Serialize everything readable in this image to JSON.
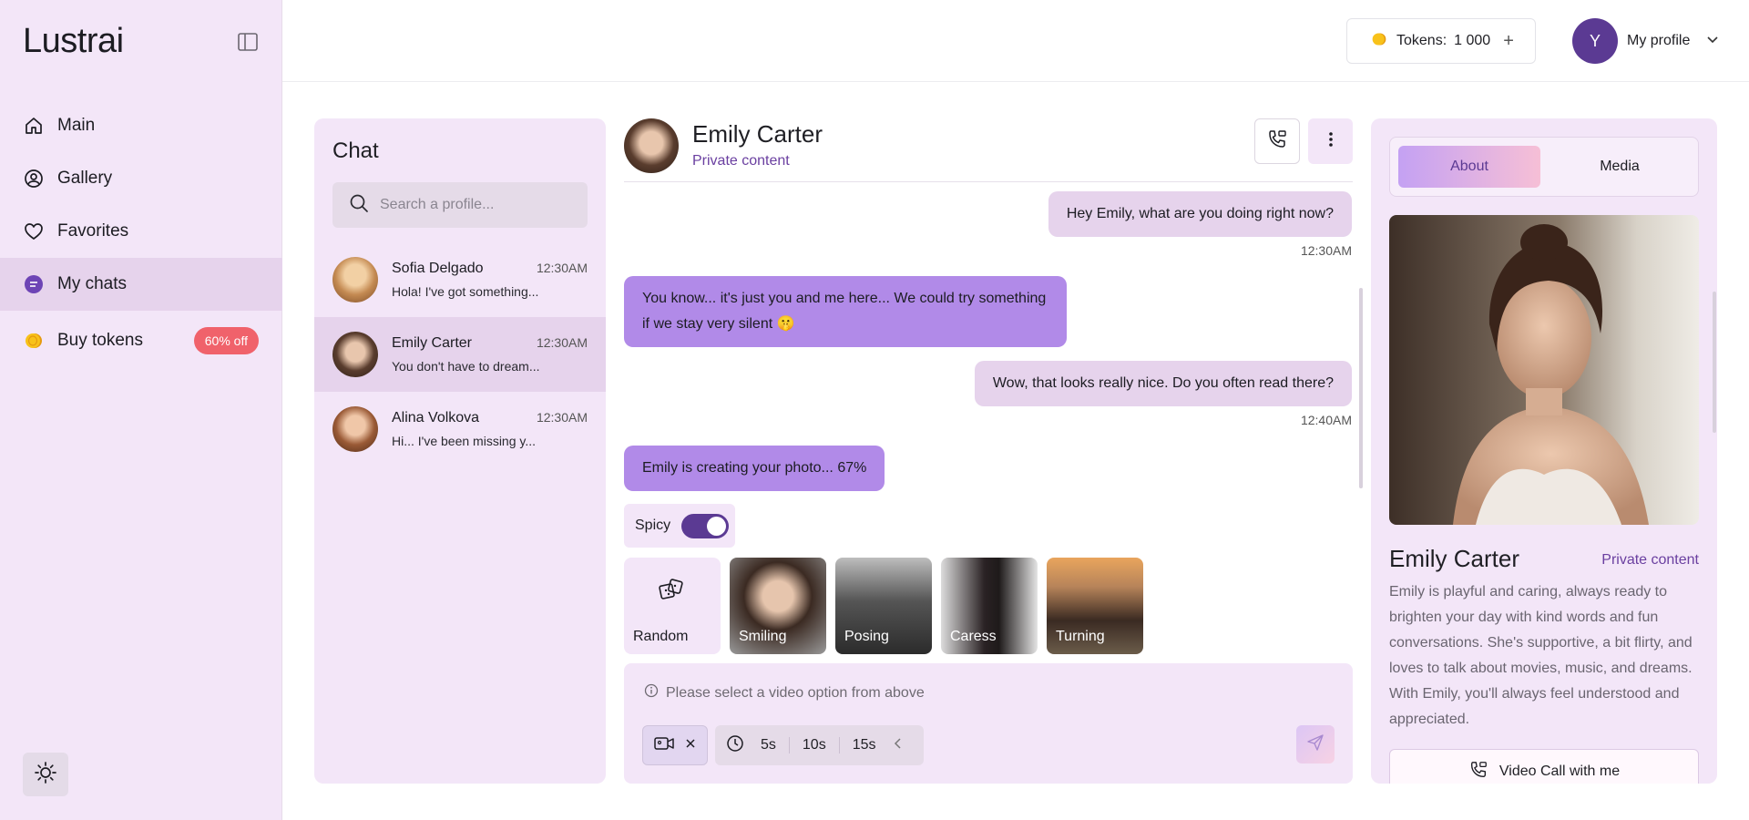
{
  "brand": "Lustrai",
  "nav": [
    {
      "label": "Main",
      "icon": "home-icon"
    },
    {
      "label": "Gallery",
      "icon": "gallery-icon"
    },
    {
      "label": "Favorites",
      "icon": "heart-icon"
    },
    {
      "label": "My chats",
      "icon": "chat-icon",
      "active": true
    },
    {
      "label": "Buy tokens",
      "icon": "coin-icon",
      "badge": "60% off"
    }
  ],
  "topbar": {
    "tokens_label": "Tokens:",
    "tokens_value": "1 000",
    "avatar_letter": "Y",
    "profile_label": "My profile"
  },
  "chat_list": {
    "title": "Chat",
    "search_placeholder": "Search a profile...",
    "items": [
      {
        "name": "Sofia Delgado",
        "time": "12:30AM",
        "preview": "Hola! I've got something...",
        "avatar_color": "#d9a779"
      },
      {
        "name": "Emily Carter",
        "time": "12:30AM",
        "preview": "You don't have to dream...",
        "avatar_color": "#8c6b55",
        "active": true
      },
      {
        "name": "Alina Volkova",
        "time": "12:30AM",
        "preview": "Hi... I've been missing y...",
        "avatar_color": "#a0684a"
      }
    ]
  },
  "chat": {
    "name": "Emily Carter",
    "subtitle": "Private content",
    "messages": [
      {
        "from": "user",
        "text": "Hey Emily, what are you doing right now?",
        "time": "12:30AM"
      },
      {
        "from": "bot",
        "text": "You know... it's just you and me here... We could try something if we stay very silent 🤫"
      },
      {
        "from": "user",
        "text": "Wow, that looks really nice. Do you often read there?",
        "time": "12:40AM"
      },
      {
        "from": "bot",
        "text": "Emily is creating your photo... 67%",
        "progress": 67
      }
    ],
    "spicy_label": "Spicy",
    "spicy_on": true,
    "options": [
      "Random",
      "Smiling",
      "Posing",
      "Caress",
      "Turning"
    ],
    "hint": "Please select a video option from above",
    "durations": [
      "5s",
      "10s",
      "15s"
    ]
  },
  "profile_panel": {
    "tabs": [
      "About",
      "Media"
    ],
    "name": "Emily Carter",
    "subtitle": "Private content",
    "bio": "Emily is playful and caring, always ready to brighten your day with kind words and fun conversations. She's supportive, a bit flirty, and loves to talk about movies, music, and dreams. With Emily, you'll always feel understood and appreciated.",
    "video_call_label": "Video Call with me"
  },
  "colors": {
    "accent": "#5b3a93",
    "panel": "#f3e6f8",
    "bot_bubble": "#b18ae8",
    "badge": "#f0626b"
  }
}
